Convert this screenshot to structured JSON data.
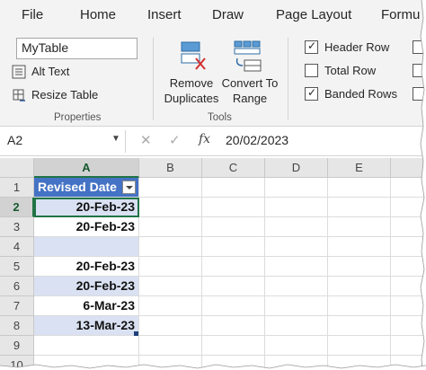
{
  "tabs": [
    "File",
    "Home",
    "Insert",
    "Draw",
    "Page Layout",
    "Formu"
  ],
  "properties": {
    "table_name": "MyTable",
    "alt_text_label": "Alt Text",
    "resize_table_label": "Resize Table",
    "group_label": "Properties"
  },
  "tools": {
    "remove_duplicates_line1": "Remove",
    "remove_duplicates_line2": "Duplicates",
    "convert_line1": "Convert To",
    "convert_line2": "Range",
    "group_label": "Tools"
  },
  "style_options": {
    "header_row": {
      "label": "Header Row",
      "checked": true
    },
    "total_row": {
      "label": "Total Row",
      "checked": false
    },
    "banded_rows": {
      "label": "Banded Rows",
      "checked": true
    }
  },
  "formula_bar": {
    "name_box": "A2",
    "cancel_glyph": "✕",
    "enter_glyph": "✓",
    "fx_label": "fx",
    "value": "20/02/2023"
  },
  "grid": {
    "columns": [
      "A",
      "B",
      "C",
      "D",
      "E"
    ],
    "selected_column": "A",
    "rows": [
      "1",
      "2",
      "3",
      "4",
      "5",
      "6",
      "7",
      "8",
      "9",
      "10"
    ],
    "selected_row": "2",
    "table_header": "Revised Date",
    "column_a_values": [
      "20-Feb-23",
      "20-Feb-23",
      "",
      "20-Feb-23",
      "20-Feb-23",
      "6-Mar-23",
      "13-Mar-23"
    ]
  },
  "colors": {
    "table_header_bg": "#4472c4",
    "band_bg": "#d9e1f2",
    "active_border": "#217346",
    "ribbon_bg": "#f3f3f3"
  }
}
